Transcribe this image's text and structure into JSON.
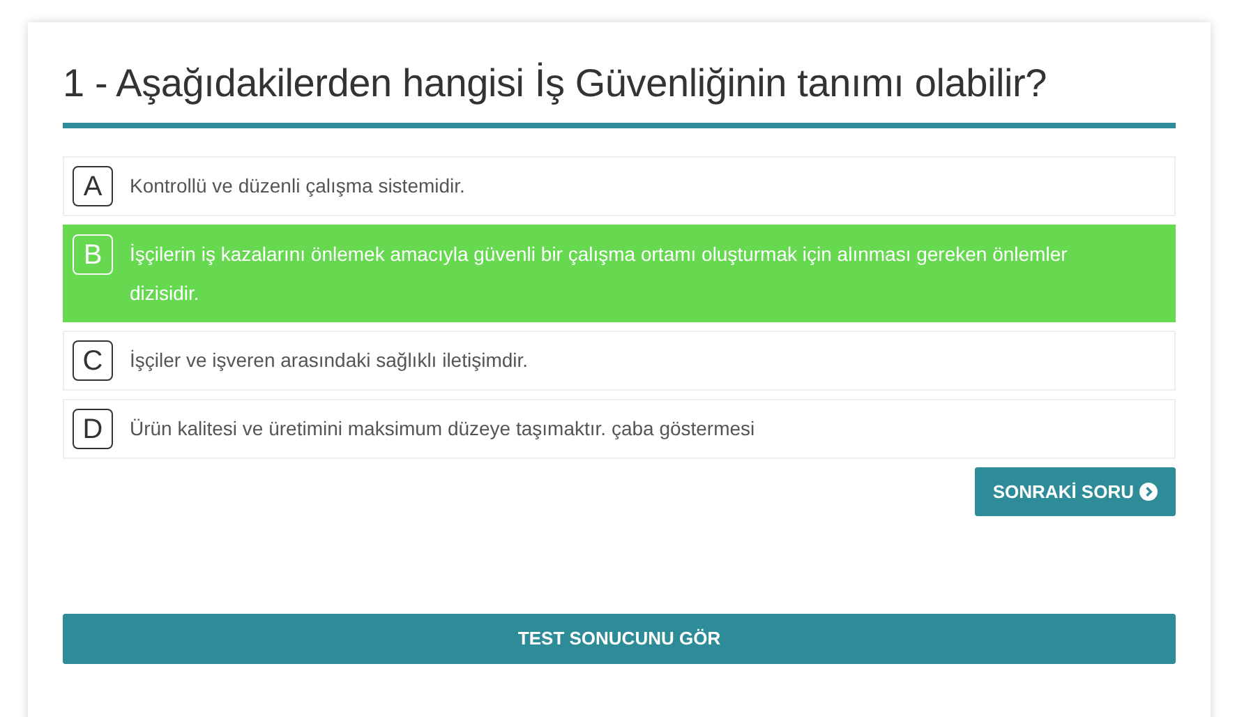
{
  "question": {
    "title": "1 - Aşağıdakilerden hangisi İş Güvenliğinin tanımı olabilir?"
  },
  "options": [
    {
      "letter": "A",
      "text": "Kontrollü ve düzenli çalışma sistemidir.",
      "selected": false
    },
    {
      "letter": "B",
      "text": "İşçilerin iş kazalarını önlemek amacıyla güvenli bir çalışma ortamı oluşturmak için alınması gereken önlemler dizisidir.",
      "selected": true
    },
    {
      "letter": "C",
      "text": "İşçiler ve işveren arasındaki sağlıklı iletişimdir.",
      "selected": false
    },
    {
      "letter": "D",
      "text": "Ürün kalitesi ve üretimini maksimum düzeye taşımaktır. çaba göstermesi",
      "selected": false
    }
  ],
  "next_button": {
    "label": "SONRAKİ SORU"
  },
  "result_button": {
    "label": "TEST SONUCUNU GÖR"
  }
}
